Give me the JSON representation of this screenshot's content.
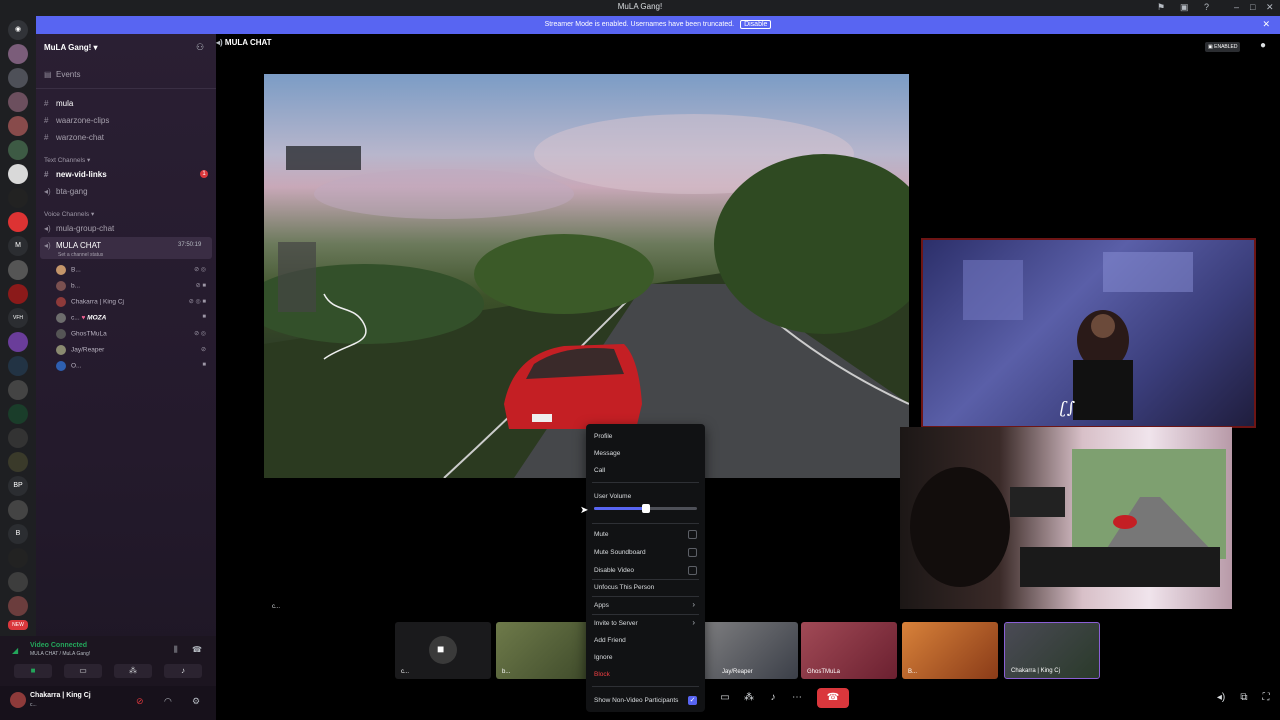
{
  "titlebar": {
    "title": "MuLA Gang!"
  },
  "banner": {
    "text": "Streamer Mode is enabled. Usernames have been truncated.",
    "button": "Disable"
  },
  "server": {
    "name": "MuLA Gang!",
    "events_label": "Events",
    "channels_top": [
      "mula",
      "waarzone-clips",
      "warzone-chat"
    ],
    "text_category": "Text Channels",
    "text_channels": [
      "new-vid-links",
      "bta-gang"
    ],
    "voice_category": "Voice Channels",
    "voice_channels": [
      "mula-group-chat",
      "MULA CHAT"
    ],
    "voice_timer": "37:50:19",
    "channel_status": "Set a channel status",
    "members": [
      "B...",
      "b...",
      "Chakarra | King Cj",
      "c...",
      "GhosTMuLa",
      "Jay/Reaper",
      "O..."
    ],
    "member_tag": "MOZA",
    "unread_badge": "1"
  },
  "rail": {
    "letters": [
      "M",
      "VFH",
      "BP",
      "B",
      "NEW"
    ]
  },
  "main": {
    "channel_title": "MULA CHAT",
    "enabled_badge": "ENABLED",
    "stray_label": "c..."
  },
  "context_menu": {
    "items_top": [
      "Profile",
      "Message",
      "Call"
    ],
    "volume_label": "User Volume",
    "volume_percent": 50,
    "checks": [
      "Mute",
      "Mute Soundboard",
      "Disable Video"
    ],
    "unfocus": "Unfocus This Person",
    "apps": "Apps",
    "invite": "Invite to Server",
    "add_friend": "Add Friend",
    "ignore": "Ignore",
    "block": "Block",
    "show_nonvideo": "Show Non-Video Participants"
  },
  "tiles": [
    "c...",
    "b...",
    "Jay/Reaper",
    "GhosTMuLa",
    "B...",
    "Chakarra | King Cj"
  ],
  "voice_panel": {
    "status": "Video Connected",
    "location": "MULA CHAT / MuLA Gang!",
    "username": "Chakarra | King Cj",
    "user_sub": "c..."
  },
  "colors": {
    "accent": "#5865f2",
    "danger": "#da373c",
    "game_car": "#c41f24"
  },
  "icons": [
    "discord-icon",
    "speaker-icon",
    "hash-icon",
    "calendar-icon",
    "settings-icon",
    "hangup-icon"
  ]
}
